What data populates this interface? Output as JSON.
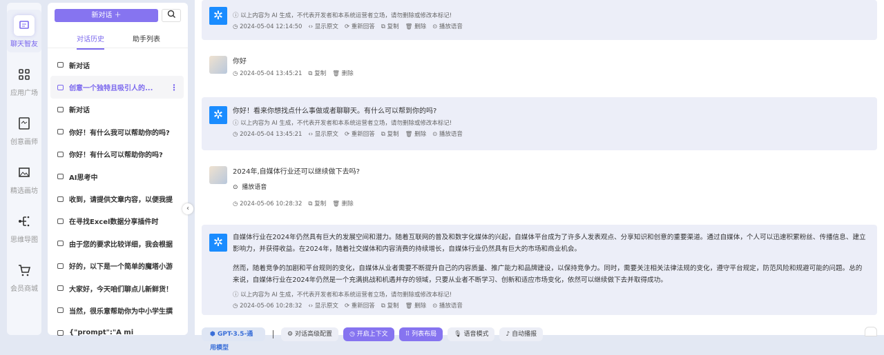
{
  "nav": [
    {
      "label": "聊天智友",
      "icon": "chat-icon",
      "active": true
    },
    {
      "label": "应用广场",
      "icon": "grid-icon"
    },
    {
      "label": "创意画师",
      "icon": "draw-icon"
    },
    {
      "label": "精选画坊",
      "icon": "gallery-icon"
    },
    {
      "label": "思维导图",
      "icon": "mindmap-icon"
    },
    {
      "label": "会员商城",
      "icon": "cart-icon"
    }
  ],
  "sidebar": {
    "new_chat": "新对话 ＋",
    "tabs": [
      "对话历史",
      "助手列表"
    ],
    "history": [
      "新对话",
      "创意一个独特且吸引人的...",
      "新对话",
      "你好！有什么我可以帮助你的吗?",
      "你好！有什么可以帮助你的吗?",
      "AI思考中",
      "收到，请提供文章内容，以便我提",
      "在寻找Excel数据分享插件时",
      "由于您的要求比较详细，我会根据",
      "好的，以下是一个简单的魔塔小游",
      "大家好，今天咱们聊点儿新鲜货！",
      "当然，很乐意帮助你为中小学生撰",
      "{\"prompt\":\"A mi"
    ]
  },
  "labels": {
    "disclaimer": "以上内容为 AI 生成，不代表开发者和本系统运营者立场，请勿删除或修改本标记!",
    "show_raw": "显示原文",
    "regenerate": "重新回答",
    "copy": "复制",
    "delete": "删除",
    "play": "播放语音"
  },
  "messages": [
    {
      "role": "ai",
      "time": "2024-05-04 12:14:50"
    },
    {
      "role": "user",
      "text": "你好",
      "time": "2024-05-04 13:45:21"
    },
    {
      "role": "ai",
      "text": "你好！看来你想找点什么事做或者聊聊天。有什么可以帮到你的吗?",
      "time": "2024-05-04 13:45:21"
    },
    {
      "role": "user",
      "text": "2024年,自媒体行业还可以继续做下去吗?",
      "time": "2024-05-06 10:28:32"
    },
    {
      "role": "ai",
      "paras": [
        "自媒体行业在2024年仍然具有巨大的发展空间和潜力。随着互联网的普及和数字化媒体的兴起，自媒体平台成为了许多人发表观点、分享知识和创意的重要渠道。通过自媒体，个人可以迅速积累粉丝、传播信息、建立影响力，并获得收益。在2024年，随着社交媒体和内容消费的持续增长，自媒体行业仍然具有巨大的市场和商业机会。",
        "然而，随着竞争的加剧和平台规则的变化，自媒体从业者需要不断提升自己的内容质量、推广能力和品牌建设，以保持竞争力。同时，需要关注相关法律法规的变化，遵守平台规定，防范风险和规避可能的问题。总的来说，自媒体行业在2024年仍然是一个充满挑战和机遇并存的领域，只要从业者不断学习、创新和适应市场变化，依然可以继续做下去并取得成功。"
      ],
      "time": "2024-05-06 10:28:32"
    }
  ],
  "toolbar": {
    "model": "GPT-3.5-通用模型",
    "advanced": "对话高级配置",
    "context": "开启上下文",
    "layout": "列表布局",
    "voice": "语音模式",
    "autoplay": "自动播报"
  },
  "colors": {
    "accent": "#8674f0",
    "ai_bg": "#eceef8",
    "logo": "#1a8cff"
  }
}
